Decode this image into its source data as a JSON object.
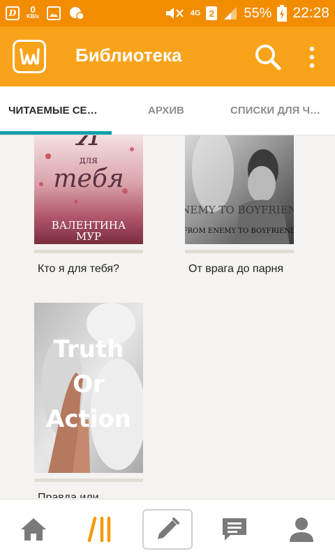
{
  "status_bar": {
    "net_speed_value": "0",
    "net_speed_unit": "KB/s",
    "network_type": "4G",
    "sim_slot": "2",
    "battery": "55%",
    "time": "22:28"
  },
  "app_bar": {
    "title": "Библиотека",
    "logo_letter": "Ш"
  },
  "tabs": [
    {
      "label": "ЧИТАЕМЫЕ СЕ…",
      "active": true
    },
    {
      "label": "АРХИВ",
      "active": false
    },
    {
      "label": "СПИСКИ ДЛЯ Ч…",
      "active": false
    }
  ],
  "books": [
    {
      "title": "Кто я для тебя?",
      "cover_lines": [
        "Я",
        "для",
        "тебя"
      ],
      "cover_author_lines": [
        "ВАЛЕНТИНА",
        "МУР"
      ]
    },
    {
      "title": "От врага до парня",
      "cover_lines": [
        "ENEMY TO BOYFRIEND",
        "FROM ENEMY TO BOYFRIEND"
      ]
    },
    {
      "title": "Правда или",
      "cover_lines": [
        "Truth",
        "Or",
        "Action"
      ]
    }
  ],
  "bottom_nav": [
    {
      "icon": "home-icon",
      "selected": false
    },
    {
      "icon": "library-icon",
      "selected": false
    },
    {
      "icon": "pencil-icon",
      "selected": true
    },
    {
      "icon": "messages-icon",
      "selected": false
    },
    {
      "icon": "profile-icon",
      "selected": false
    }
  ],
  "colors": {
    "status_bar": "#f28c00",
    "app_bar": "#f9a31b",
    "tab_indicator": "#15a0a8",
    "library_icon": "#f59a0c",
    "nav_icon": "#7a7a7a"
  }
}
